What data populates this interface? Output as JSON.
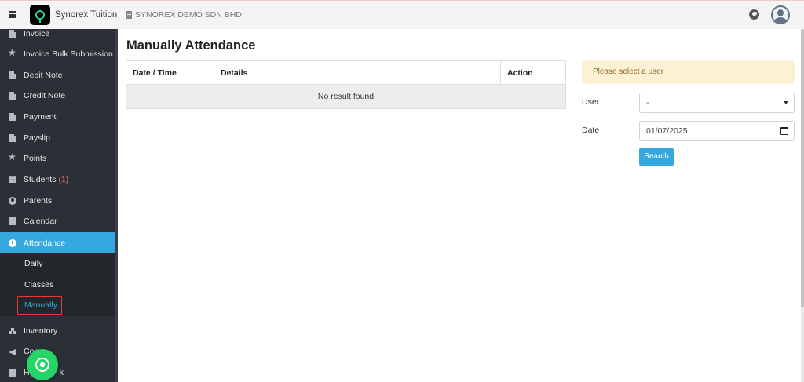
{
  "header": {
    "app_title": "Synorex Tuition",
    "company": "SYNOREX DEMO SDN BHD"
  },
  "sidebar": {
    "items": [
      {
        "label": "Invoice",
        "icon": "document-icon"
      },
      {
        "label": "Invoice Bulk Submission",
        "icon": "star-icon"
      },
      {
        "label": "Debit Note",
        "icon": "document-icon"
      },
      {
        "label": "Credit Note",
        "icon": "document-icon"
      },
      {
        "label": "Payment",
        "icon": "document-icon"
      },
      {
        "label": "Payslip",
        "icon": "document-icon"
      },
      {
        "label": "Points",
        "icon": "star-icon"
      },
      {
        "label": "Students",
        "icon": "users-icon",
        "badge": "(1)"
      },
      {
        "label": "Parents",
        "icon": "person-circle-icon"
      },
      {
        "label": "Calendar",
        "icon": "calendar-icon"
      },
      {
        "label": "Attendance",
        "icon": "clock-icon",
        "active": true
      },
      {
        "label": "Inventory",
        "icon": "boxes-icon"
      },
      {
        "label": "Con",
        "icon": "megaphone-icon"
      },
      {
        "label": "H",
        "suffix": "k",
        "icon": "book-icon"
      }
    ],
    "subitems": [
      {
        "label": "Daily"
      },
      {
        "label": "Classes"
      },
      {
        "label": "Manually",
        "current": true
      }
    ]
  },
  "main": {
    "title": "Manually Attendance",
    "table": {
      "columns": [
        "Date / Time",
        "Details",
        "Action"
      ],
      "empty_text": "No result found"
    },
    "form": {
      "alert": "Please select a user",
      "user_label": "User",
      "user_value": "-",
      "date_label": "Date",
      "date_value": "01/07/2025",
      "search_label": "Search"
    }
  },
  "colors": {
    "accent": "#35a8e0",
    "sidebar_bg": "#2b3036",
    "alert_bg": "#fdf1d3",
    "badge_red": "#ff6b6b",
    "whatsapp_green": "#25d366"
  }
}
